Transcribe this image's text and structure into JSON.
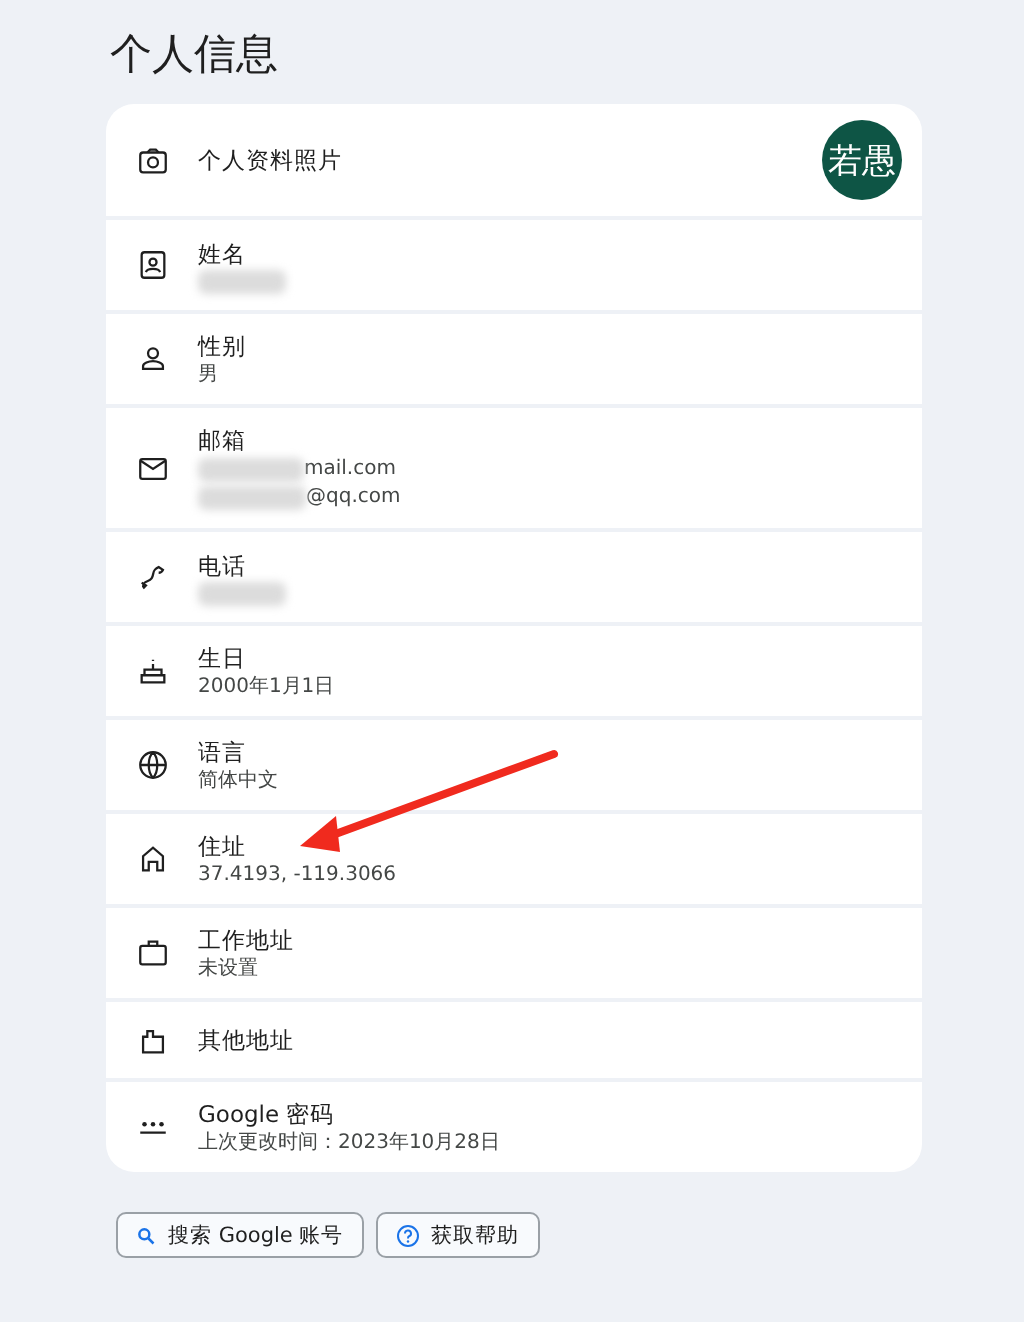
{
  "title": "个人信息",
  "rows": [
    {
      "kind": "photo",
      "label": "个人资料照片",
      "avatar": "若愚"
    },
    {
      "kind": "field",
      "label": "姓名",
      "lines": [
        {
          "redacted": true
        }
      ]
    },
    {
      "kind": "field",
      "label": "性别",
      "lines": [
        {
          "text": "男",
          "redacted": false
        }
      ]
    },
    {
      "kind": "field",
      "label": "邮箱",
      "lines": [
        {
          "text": "mail.com",
          "redacted": true
        },
        {
          "text": "@qq.com",
          "redacted": true
        }
      ]
    },
    {
      "kind": "field",
      "label": "电话",
      "lines": [
        {
          "redacted": true
        }
      ]
    },
    {
      "kind": "field",
      "label": "生日",
      "lines": [
        {
          "text": "2000年1月1日",
          "redacted": false
        }
      ]
    },
    {
      "kind": "field",
      "label": "语言",
      "lines": [
        {
          "text": "简体中文",
          "redacted": false
        }
      ]
    },
    {
      "kind": "field",
      "label": "住址",
      "lines": [
        {
          "text": "37.4193, -119.3066",
          "redacted": false
        }
      ]
    },
    {
      "kind": "field",
      "label": "工作地址",
      "lines": [
        {
          "text": "未设置",
          "redacted": false
        }
      ]
    },
    {
      "kind": "field",
      "label": "其他地址"
    },
    {
      "kind": "field",
      "label": "Google 密码",
      "lines": [
        {
          "text": "上次更改时间：2023年10月28日",
          "redacted": false
        }
      ]
    }
  ],
  "arrow_annotation": true,
  "buttons": [
    {
      "label": "搜索 Google 账号"
    },
    {
      "label": "获取帮助"
    }
  ]
}
